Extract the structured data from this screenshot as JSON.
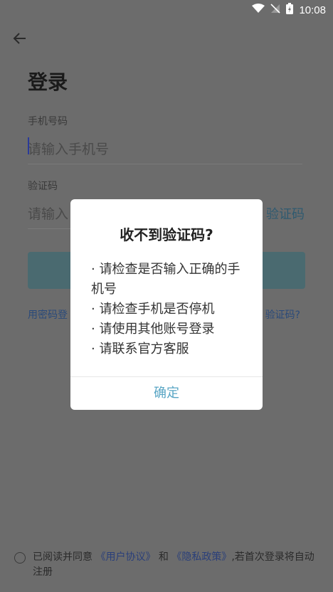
{
  "status_bar": {
    "time": "10:08"
  },
  "page": {
    "title": "登录",
    "phone_label": "手机号码",
    "phone_placeholder": "请输入手机号",
    "code_label": "验证码",
    "code_placeholder_partial": "请输入",
    "get_code_partial": "验证码",
    "link_left_partial": "用密码登",
    "link_right_partial": "验证码?"
  },
  "agreement": {
    "prefix": "已阅读并同意",
    "user_agreement": "《用户协议》",
    "and": "和",
    "privacy_policy": "《隐私政策》",
    "suffix": ",若首次登录将自动注册"
  },
  "dialog": {
    "title": "收不到验证码?",
    "items": [
      "· 请检查是否输入正确的手机号",
      "· 请检查手机是否停机",
      "· 请使用其他账号登录",
      "· 请联系官方客服"
    ],
    "ok_label": "确定"
  }
}
